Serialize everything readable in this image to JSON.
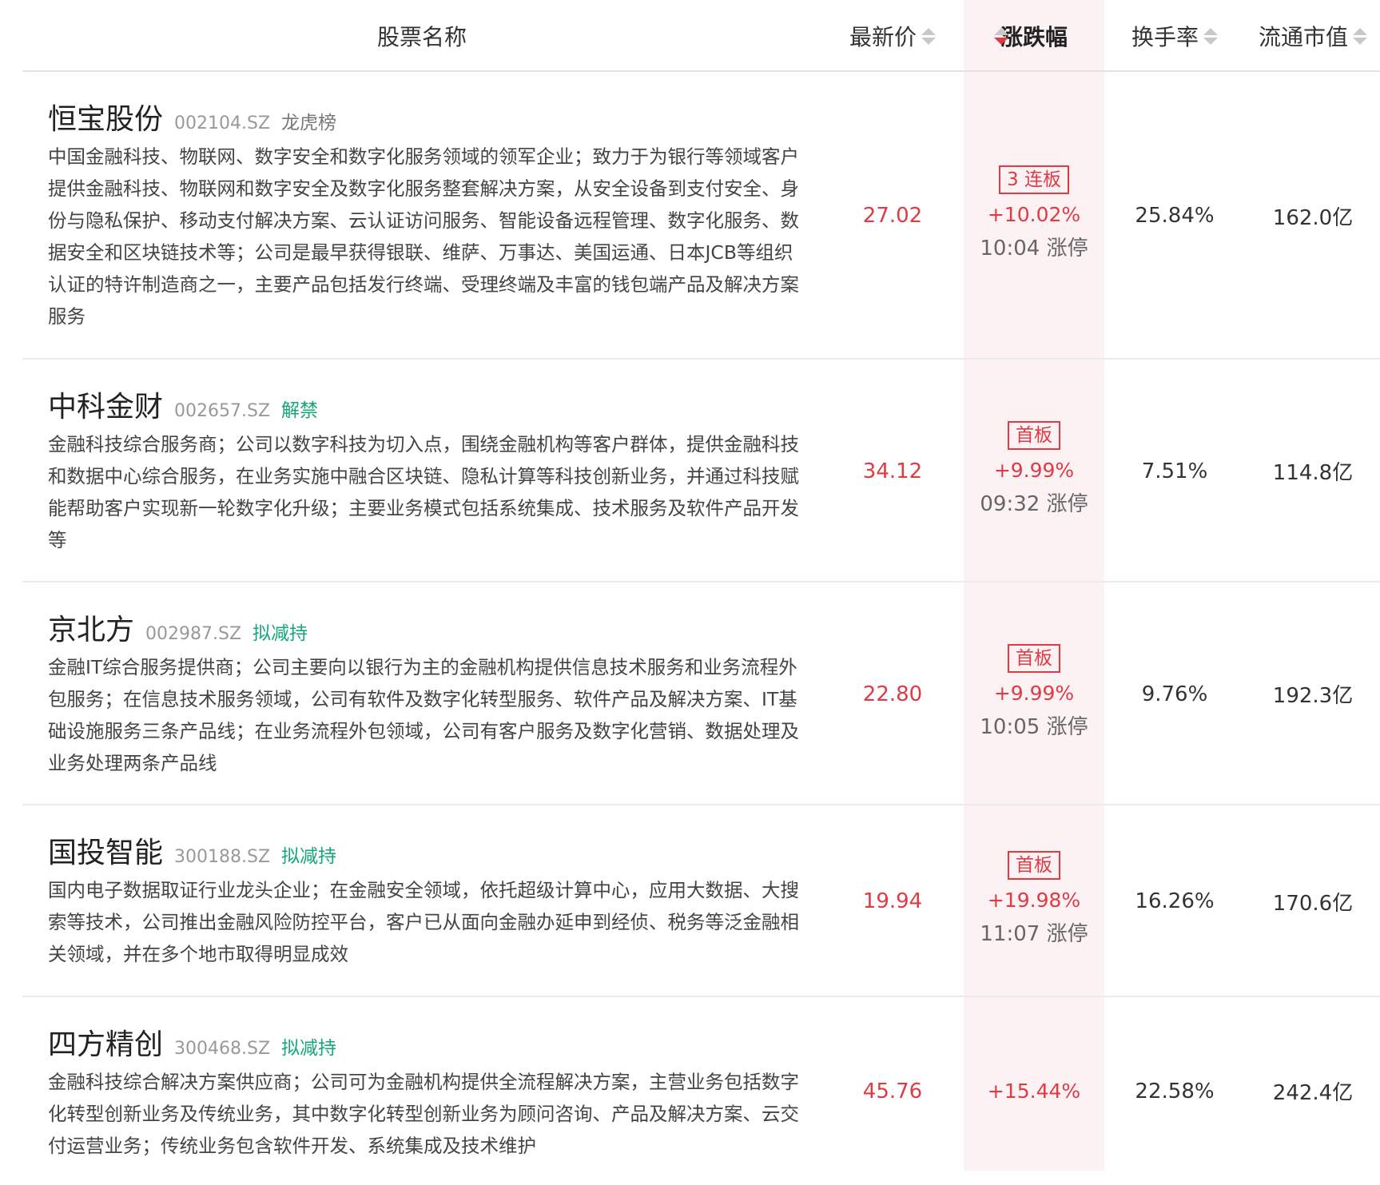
{
  "colors": {
    "up_red": "#e03a45",
    "tag_green": "#15a67a",
    "highlight_bg": "#fdf2f3"
  },
  "header": {
    "name": "股票名称",
    "price": "最新价",
    "change": "涨跌幅",
    "turnover": "换手率",
    "market_cap": "流通市值"
  },
  "rows": [
    {
      "name": "恒宝股份",
      "code": "002104.SZ",
      "tag": "龙虎榜",
      "tag_color": "gray",
      "desc": "中国金融科技、物联网、数字安全和数字化服务领域的领军企业；致力于为银行等领域客户提供金融科技、物联网和数字安全及数字化服务整套解决方案，从安全设备到支付安全、身份与隐私保护、移动支付解决方案、云认证访问服务、智能设备远程管理、数字化服务、数据安全和区块链技术等；公司是最早获得银联、维萨、万事达、美国运通、日本JCB等组织认证的特许制造商之一，主要产品包括发行终端、受理终端及丰富的钱包端产品及解决方案服务",
      "price": "27.02",
      "board": "3 连板",
      "change": "+10.02%",
      "limit_time": "10:04 涨停",
      "turnover": "25.84%",
      "market_cap": "162.0亿"
    },
    {
      "name": "中科金财",
      "code": "002657.SZ",
      "tag": "解禁",
      "tag_color": "green",
      "desc": "金融科技综合服务商；公司以数字科技为切入点，围绕金融机构等客户群体，提供金融科技和数据中心综合服务，在业务实施中融合区块链、隐私计算等科技创新业务，并通过科技赋能帮助客户实现新一轮数字化升级；主要业务模式包括系统集成、技术服务及软件产品开发等",
      "price": "34.12",
      "board": "首板",
      "change": "+9.99%",
      "limit_time": "09:32 涨停",
      "turnover": "7.51%",
      "market_cap": "114.8亿"
    },
    {
      "name": "京北方",
      "code": "002987.SZ",
      "tag": "拟减持",
      "tag_color": "green",
      "desc": "金融IT综合服务提供商；公司主要向以银行为主的金融机构提供信息技术服务和业务流程外包服务；在信息技术服务领域，公司有软件及数字化转型服务、软件产品及解决方案、IT基础设施服务三条产品线；在业务流程外包领域，公司有客户服务及数字化营销、数据处理及业务处理两条产品线",
      "price": "22.80",
      "board": "首板",
      "change": "+9.99%",
      "limit_time": "10:05 涨停",
      "turnover": "9.76%",
      "market_cap": "192.3亿"
    },
    {
      "name": "国投智能",
      "code": "300188.SZ",
      "tag": "拟减持",
      "tag_color": "green",
      "desc": "国内电子数据取证行业龙头企业；在金融安全领域，依托超级计算中心，应用大数据、大搜索等技术，公司推出金融风险防控平台，客户已从面向金融办延申到经侦、税务等泛金融相关领域，并在多个地市取得明显成效",
      "price": "19.94",
      "board": "首板",
      "change": "+19.98%",
      "limit_time": "11:07 涨停",
      "turnover": "16.26%",
      "market_cap": "170.6亿"
    },
    {
      "name": "四方精创",
      "code": "300468.SZ",
      "tag": "拟减持",
      "tag_color": "green",
      "desc": "金融科技综合解决方案供应商；公司可为金融机构提供全流程解决方案，主营业务包括数字化转型创新业务及传统业务，其中数字化转型创新业务为顾问咨询、产品及解决方案、云交付运营业务；传统业务包含软件开发、系统集成及技术维护",
      "price": "45.76",
      "board": "",
      "change": "+15.44%",
      "limit_time": "",
      "turnover": "22.58%",
      "market_cap": "242.4亿"
    }
  ]
}
